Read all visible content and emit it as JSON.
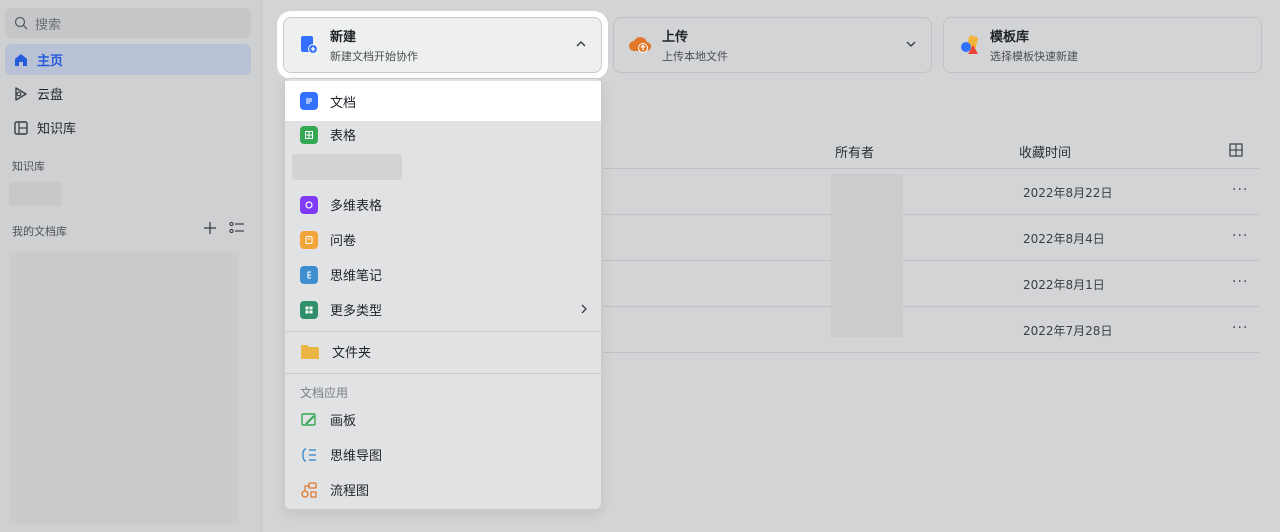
{
  "sidebar": {
    "search_placeholder": "搜索",
    "items": [
      {
        "label": "主页",
        "active": true
      },
      {
        "label": "云盘",
        "active": false
      },
      {
        "label": "知识库",
        "active": false
      }
    ],
    "section_wiki": "知识库",
    "section_my_docs": "我的文档库"
  },
  "cards": [
    {
      "title": "新建",
      "subtitle": "新建文档开始协作"
    },
    {
      "title": "上传",
      "subtitle": "上传本地文件"
    },
    {
      "title": "模板库",
      "subtitle": "选择模板快速新建"
    }
  ],
  "table": {
    "owner_header": "所有者",
    "time_header": "收藏时间",
    "dates": [
      "2022年8月22日",
      "2022年8月4日",
      "2022年8月1日",
      "2022年7月28日"
    ],
    "more_glyph": "···"
  },
  "menu": {
    "items": [
      {
        "label": "文档",
        "icon": "doc-icon",
        "color": "#3370ff"
      },
      {
        "label": "表格",
        "icon": "sheet-icon",
        "color": "#34a853"
      },
      {
        "label": "多维表格",
        "icon": "bitable-icon",
        "color": "#7f3bf5"
      },
      {
        "label": "问卷",
        "icon": "survey-icon",
        "color": "#f0a43a"
      },
      {
        "label": "思维笔记",
        "icon": "mindnote-icon",
        "color": "#3e8ed0"
      },
      {
        "label": "更多类型",
        "icon": "more-types-icon",
        "color": "#2e8f6a"
      },
      {
        "label": "文件夹",
        "icon": "folder-icon",
        "color": "#e9b643"
      }
    ],
    "apps_section": "文档应用",
    "apps": [
      {
        "label": "画板",
        "icon": "whiteboard-icon",
        "color": "#34a853"
      },
      {
        "label": "思维导图",
        "icon": "mindmap-icon",
        "color": "#3e8ed0"
      },
      {
        "label": "流程图",
        "icon": "flowchart-icon",
        "color": "#e0772b"
      }
    ]
  }
}
